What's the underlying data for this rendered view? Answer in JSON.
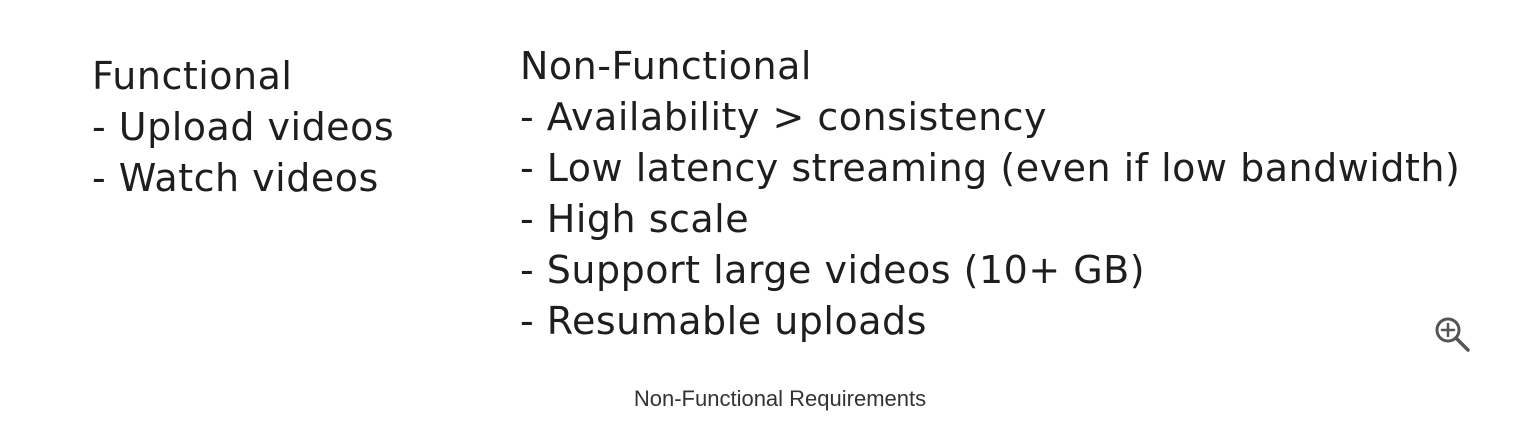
{
  "figure": {
    "caption": "Non-Functional Requirements",
    "zoom_icon": "zoom-in-icon"
  },
  "functional": {
    "title": "Functional",
    "items": [
      "- Upload videos",
      "- Watch videos"
    ]
  },
  "non_functional": {
    "title": "Non-Functional",
    "items": [
      "- Availability > consistency",
      "- Low latency streaming (even if low bandwidth)",
      "- High scale",
      "- Support large videos (10+ GB)",
      "- Resumable uploads"
    ]
  },
  "colors": {
    "ink": "#1e1e1e",
    "caption": "#333333",
    "icon": "#555555"
  }
}
